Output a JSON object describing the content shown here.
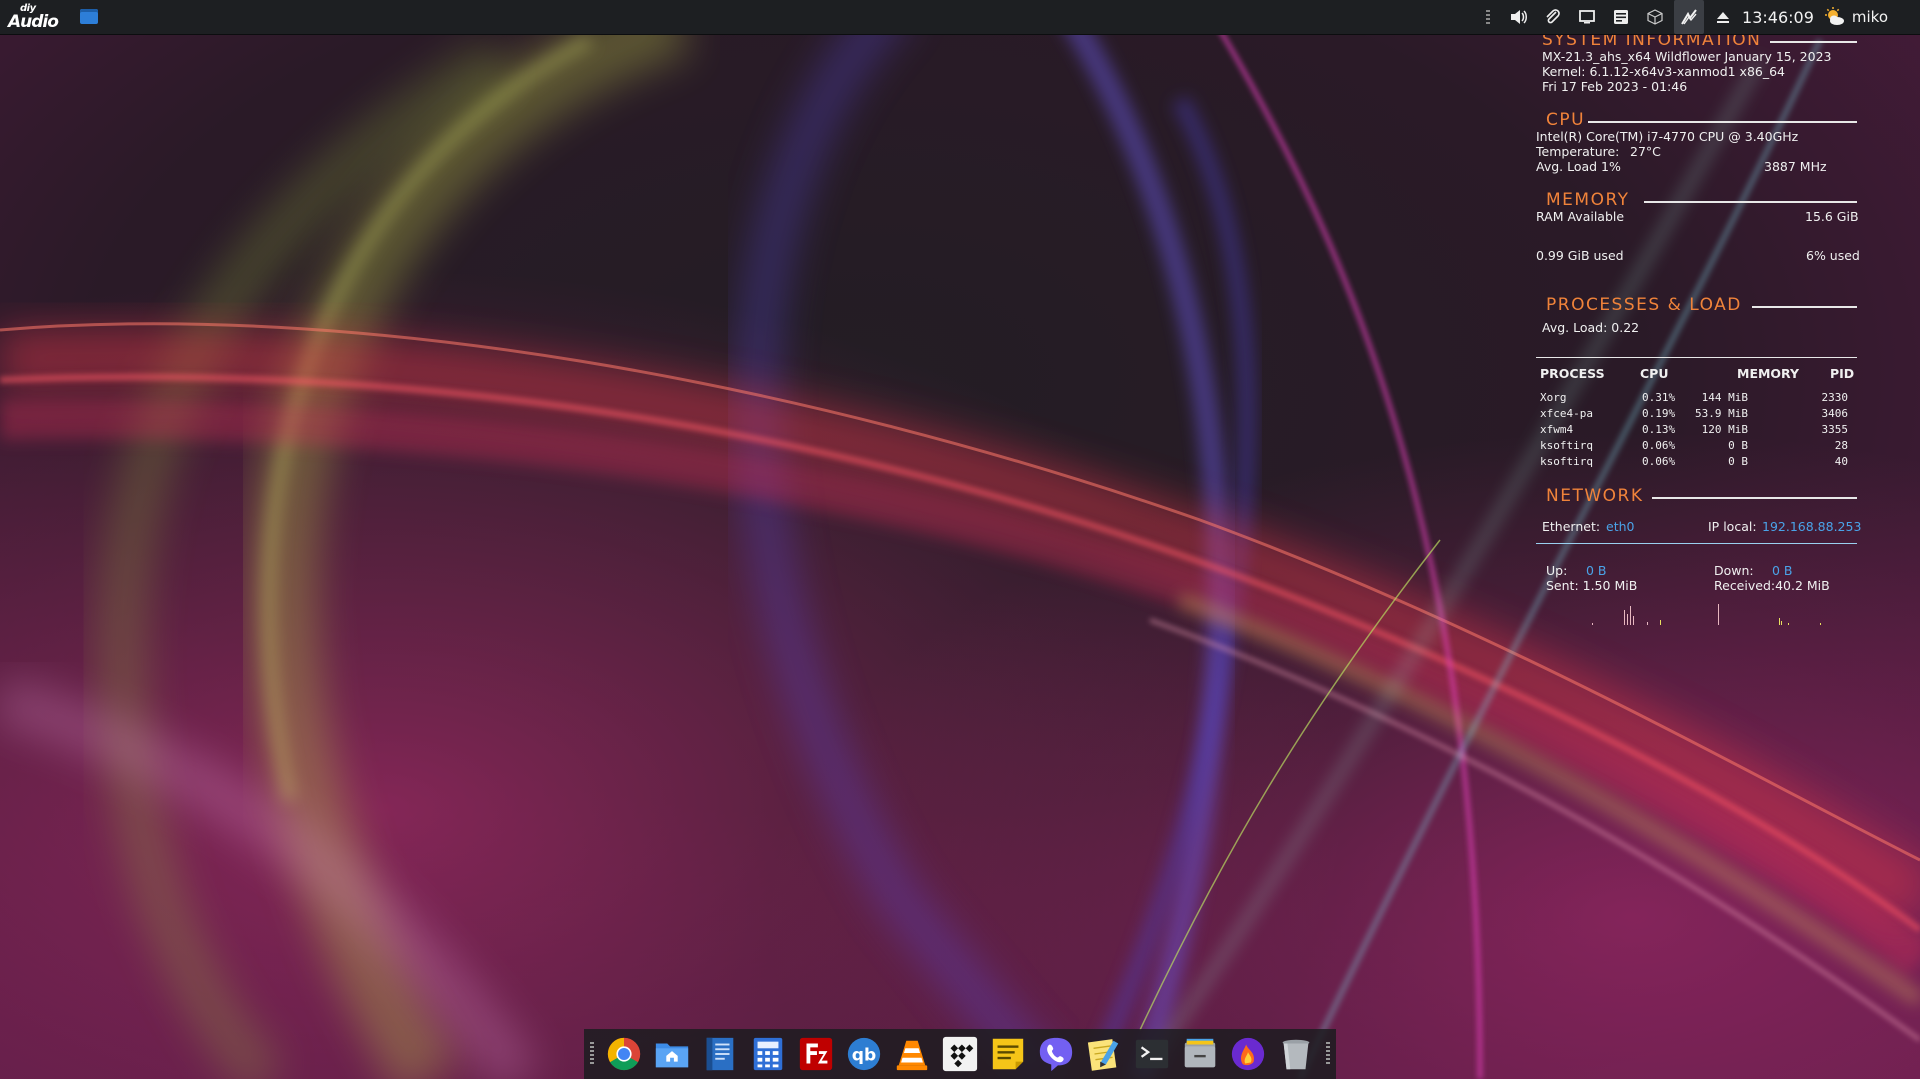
{
  "top_panel": {
    "logo_line1": "diy",
    "logo_line2": "Audio",
    "tray_icons": [
      "overflow-handle",
      "volume-icon",
      "paperclip-icon",
      "display-icon",
      "notes-icon",
      "package-icon",
      "update-icon",
      "eject-icon"
    ],
    "clock": "13:46:09",
    "username": "miko"
  },
  "conky": {
    "system": {
      "header": "SYSTEM INFORMATION",
      "distro": "MX-21.3_ahs_x64 Wildflower January 15, 2023",
      "kernel": "Kernel: 6.1.12-x64v3-xanmod1 x86_64",
      "date": "Fri 17 Feb 2023 - 01:46"
    },
    "cpu": {
      "header": "CPU",
      "model": "Intel(R) Core(TM) i7-4770 CPU @ 3.40GHz",
      "temp_label": "Temperature:",
      "temp_value": "27°C",
      "avg_load": "Avg. Load 1%",
      "freq": "3887 MHz"
    },
    "memory": {
      "header": "MEMORY",
      "ram_label": "RAM Available",
      "ram_value": "15.6 GiB",
      "used_label": "0.99 GiB used",
      "used_pct": "6% used"
    },
    "processes": {
      "header": "PROCESSES & LOAD",
      "avg_load": "Avg. Load: 0.22",
      "columns": [
        "PROCESS",
        "CPU",
        "MEMORY",
        "PID"
      ],
      "rows": [
        {
          "name": "Xorg",
          "cpu": "0.31%",
          "mem": "144 MiB",
          "pid": "2330"
        },
        {
          "name": "xfce4-pa",
          "cpu": "0.19%",
          "mem": "53.9 MiB",
          "pid": "3406"
        },
        {
          "name": "xfwm4",
          "cpu": "0.13%",
          "mem": "120 MiB",
          "pid": "3355"
        },
        {
          "name": "ksoftirq",
          "cpu": "0.06%",
          "mem": "0 B",
          "pid": "28"
        },
        {
          "name": "ksoftirq",
          "cpu": "0.06%",
          "mem": "0 B",
          "pid": "40"
        }
      ]
    },
    "network": {
      "header": "NETWORK",
      "eth_label": "Ethernet:",
      "eth_value": "eth0",
      "ip_label": "IP local:",
      "ip_value": "192.168.88.253",
      "up_label": "Up:",
      "up_value": "0 B",
      "down_label": "Down:",
      "down_value": "0 B",
      "sent": "Sent: 1.50 MiB",
      "received": "Received:40.2 MiB"
    }
  },
  "dock": {
    "items": [
      "chrome-icon",
      "home-folder-icon",
      "text-editor-icon",
      "calculator-icon",
      "filezilla-icon",
      "qbittorrent-icon",
      "vlc-icon",
      "tidal-icon",
      "sticky-notes-icon",
      "viber-icon",
      "notepad-icon",
      "terminal-icon",
      "file-manager-icon",
      "stacer-icon",
      "trash-icon"
    ]
  },
  "colors": {
    "accent_orange": "#f0833a",
    "link_blue": "#4aa3e8",
    "panel_bg": "#1d1f22"
  }
}
